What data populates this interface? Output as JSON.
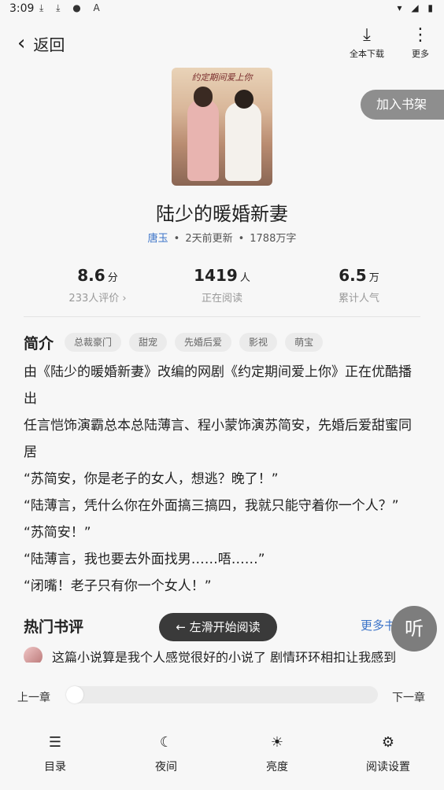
{
  "status_bar": {
    "time": "3:09",
    "left_icons": "⤓ ⤓ ● A",
    "right_icons": "▾ ◢ ▮"
  },
  "header": {
    "back_label": "返回",
    "download_label": "全本下载",
    "more_label": "更多"
  },
  "cover": {
    "title_art": "约定期间爱上你"
  },
  "add_to_shelf": "加入书架",
  "book": {
    "title": "陆少的暖婚新妻",
    "author": "唐玉",
    "updated": "2天前更新",
    "word_count": "1788万字"
  },
  "stats": {
    "score": {
      "value": "8.6",
      "unit": "分",
      "label": "233人评价 ›"
    },
    "readers": {
      "value": "1419",
      "unit": "人",
      "label": "正在阅读"
    },
    "popularity": {
      "value": "6.5",
      "unit": "万",
      "label": "累计人气"
    }
  },
  "intro": {
    "heading": "简介",
    "tags": [
      "总裁豪门",
      "甜宠",
      "先婚后爱",
      "影视",
      "萌宝"
    ],
    "lines": [
      "由《陆少的暖婚新妻》改编的网剧《约定期间爱上你》正在优酷播",
      "出",
      "任言恺饰演霸总本总陆薄言、程小蒙饰演苏简安，先婚后爱甜蜜同",
      "居",
      "“苏简安，你是老子的女人，想逃？晚了！”",
      "“陆薄言，凭什么你在外面搞三搞四，我就只能守着你一个人？”",
      "“苏简安！”",
      "“陆薄言，我也要去外面找男……唔……”",
      "“闭嘴！老子只有你一个女人！”"
    ]
  },
  "reviews": {
    "heading": "热门书评",
    "more": "更多书评",
    "first_review": "这篇小说算是我个人感觉很好的小说了 剧情环环相扣让我感到"
  },
  "swipe_hint": "← 左滑开始阅读",
  "listen_label": "听",
  "reader_controls": {
    "prev_chapter": "上一章",
    "next_chapter": "下一章",
    "progress": 0
  },
  "bottom_nav": [
    {
      "label": "目录",
      "icon": "toc-icon",
      "glyph": "☰"
    },
    {
      "label": "夜间",
      "icon": "moon-icon",
      "glyph": "☾"
    },
    {
      "label": "亮度",
      "icon": "sun-icon",
      "glyph": "☀"
    },
    {
      "label": "阅读设置",
      "icon": "settings-icon",
      "glyph": "⚙"
    }
  ]
}
